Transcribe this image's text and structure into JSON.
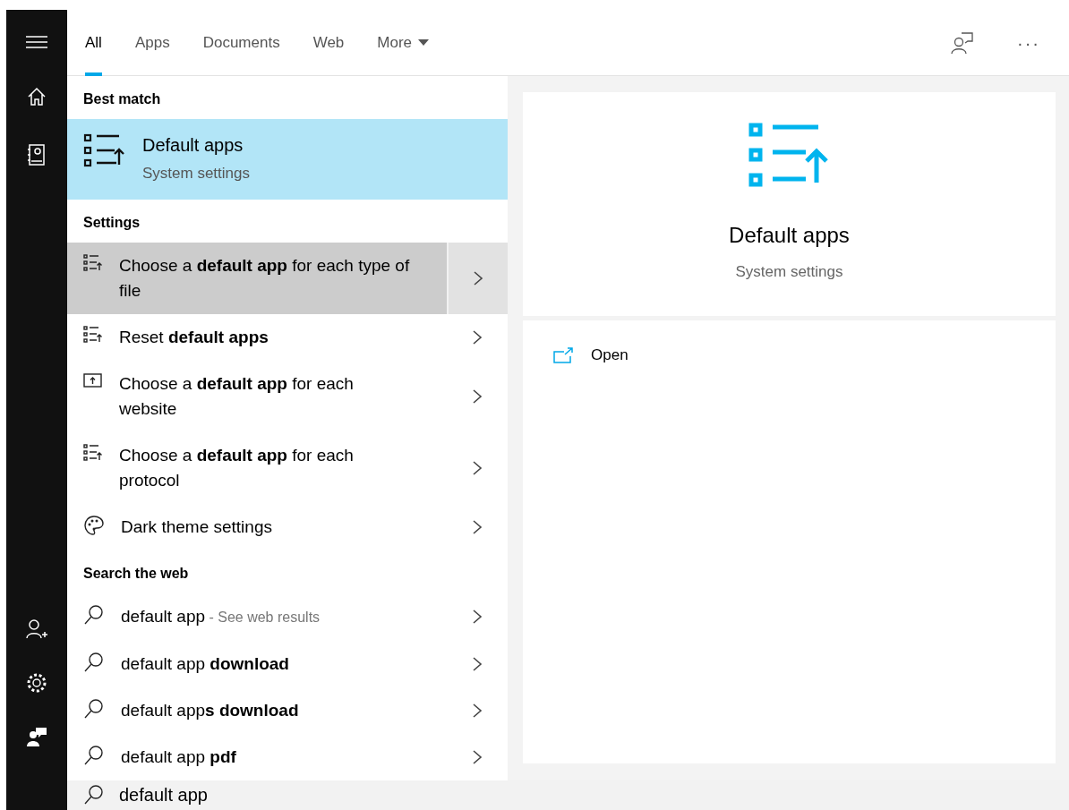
{
  "tabs": [
    {
      "label": "All",
      "selected": true,
      "caret": false
    },
    {
      "label": "Apps",
      "selected": false,
      "caret": false
    },
    {
      "label": "Documents",
      "selected": false,
      "caret": false
    },
    {
      "label": "Web",
      "selected": false,
      "caret": false
    },
    {
      "label": "More",
      "selected": false,
      "caret": true
    }
  ],
  "toolbar": {
    "more_label": "···"
  },
  "sections": [
    {
      "heading": "Best match",
      "items": [
        {
          "kind": "best",
          "title": "Default apps",
          "subtitle": "System settings",
          "selected": true
        }
      ]
    },
    {
      "heading": "Settings",
      "items": [
        {
          "kind": "list",
          "text": "Choose a **default app** for each type of file",
          "selected": true
        },
        {
          "kind": "list",
          "text": "Reset **default apps**",
          "selected": false
        },
        {
          "kind": "website",
          "text": "Choose a **default app** for each website",
          "selected": false
        },
        {
          "kind": "list",
          "text": "Choose a **default app** for each protocol",
          "selected": false
        },
        {
          "kind": "palette",
          "text": "Dark theme settings",
          "selected": false
        }
      ]
    },
    {
      "heading": "Search the web",
      "items": [
        {
          "kind": "search",
          "text": "default app",
          "hint": "- See web results",
          "selected": false
        },
        {
          "kind": "search",
          "text": "default app **download**",
          "selected": false
        },
        {
          "kind": "search",
          "text": "default app**s download**",
          "selected": false
        },
        {
          "kind": "search",
          "text": "default app **pdf**",
          "selected": false
        }
      ]
    }
  ],
  "preview": {
    "title": "Default apps",
    "subtitle": "System settings",
    "actions": [
      {
        "label": "Open"
      }
    ]
  },
  "search": {
    "value": "default app"
  }
}
